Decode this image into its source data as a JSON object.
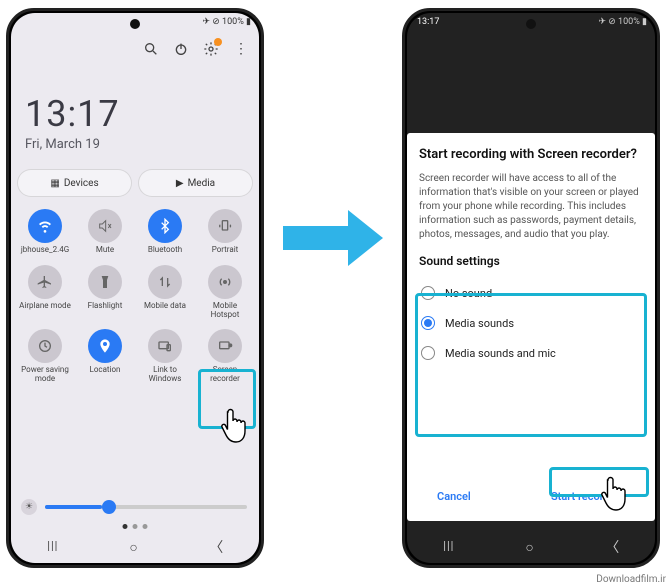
{
  "left": {
    "status": {
      "right": "✈ ⊘ 100% ▮",
      "icons": "🔌⚙"
    },
    "clock": {
      "time": "13:17",
      "date": "Fri, March 19"
    },
    "toolbar": {
      "search": "search-icon",
      "power": "power-icon",
      "gear": "gear-icon",
      "menu": "menu-icon"
    },
    "dm": {
      "devices": "Devices",
      "media": "Media"
    },
    "tiles": [
      {
        "name": "wifi",
        "label": "jbhouse_2.4G",
        "on": true
      },
      {
        "name": "mute",
        "label": "Mute",
        "on": false
      },
      {
        "name": "bluetooth",
        "label": "Bluetooth",
        "on": true
      },
      {
        "name": "portrait",
        "label": "Portrait",
        "on": false
      },
      {
        "name": "airplane",
        "label": "Airplane mode",
        "on": false
      },
      {
        "name": "flashlight",
        "label": "Flashlight",
        "on": false
      },
      {
        "name": "mobiledata",
        "label": "Mobile data",
        "on": false
      },
      {
        "name": "hotspot",
        "label": "Mobile Hotspot",
        "on": false
      },
      {
        "name": "powersave",
        "label": "Power saving mode",
        "on": false
      },
      {
        "name": "location",
        "label": "Location",
        "on": true
      },
      {
        "name": "linkwin",
        "label": "Link to Windows",
        "on": false
      },
      {
        "name": "screenrec",
        "label": "Screen recorder",
        "on": false
      }
    ],
    "slider": {
      "percent": 28
    }
  },
  "right": {
    "status_time": "13:17",
    "status_right": "✈ ⊘ 100% ▮",
    "sheet": {
      "title": "Start recording with Screen recorder?",
      "body": "Screen recorder will have access to all of the information that's visible on your screen or played from your phone while recording. This includes information such as passwords, payment details, photos, messages, and audio that you play.",
      "sound_header": "Sound settings",
      "options": [
        {
          "label": "No sound",
          "selected": false
        },
        {
          "label": "Media sounds",
          "selected": true
        },
        {
          "label": "Media sounds and mic",
          "selected": false
        }
      ],
      "cancel": "Cancel",
      "start": "Start recording"
    }
  },
  "watermark": "Downloadfilm.ir"
}
